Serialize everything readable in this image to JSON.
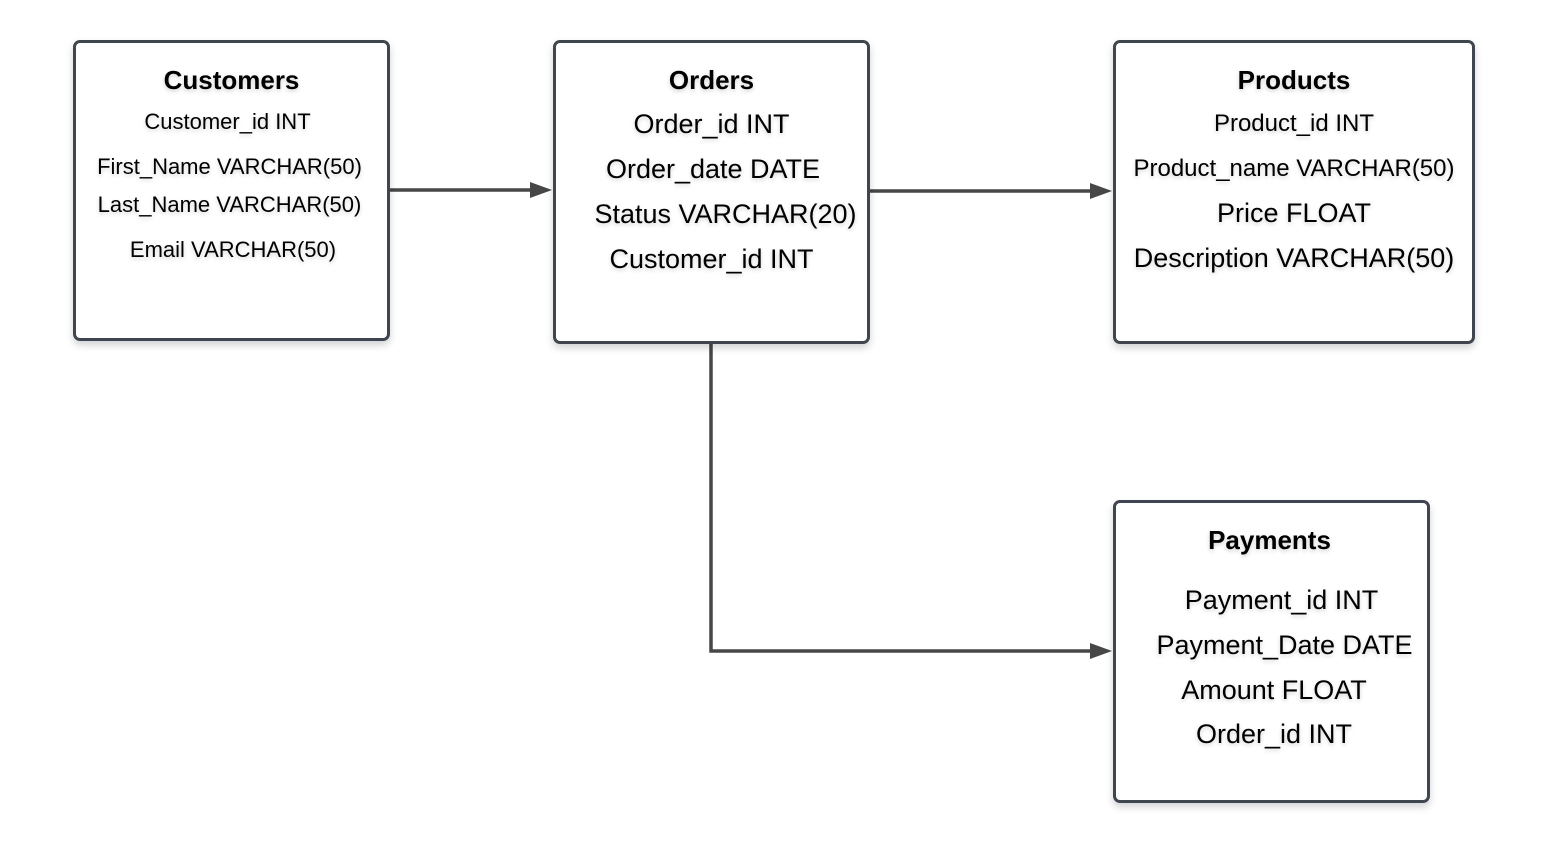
{
  "diagram": {
    "type": "entity-relationship",
    "colors": {
      "border": "#3f4650",
      "connector": "#474747",
      "background": "#ffffff",
      "text": "#000000"
    },
    "entities": [
      {
        "id": "customers",
        "name": "Customers",
        "attributes": [
          "Customer_id INT",
          "First_Name VARCHAR(50)",
          "Last_Name VARCHAR(50)",
          "Email VARCHAR(50)"
        ]
      },
      {
        "id": "orders",
        "name": "Orders",
        "attributes": [
          "Order_id INT",
          "Order_date DATE",
          "Status VARCHAR(20)",
          "Customer_id INT"
        ]
      },
      {
        "id": "products",
        "name": "Products",
        "attributes": [
          "Product_id INT",
          "Product_name VARCHAR(50)",
          "Price FLOAT",
          "Description VARCHAR(50)"
        ]
      },
      {
        "id": "payments",
        "name": "Payments",
        "attributes": [
          "Payment_id INT",
          "Payment_Date DATE",
          "Amount FLOAT",
          "Order_id INT"
        ]
      }
    ],
    "relationships": [
      {
        "from": "Customers",
        "to": "Orders",
        "arrow": "filled-triangle"
      },
      {
        "from": "Orders",
        "to": "Products",
        "arrow": "filled-triangle"
      },
      {
        "from": "Orders",
        "to": "Payments",
        "arrow": "filled-triangle",
        "routing": "elbow"
      }
    ]
  }
}
